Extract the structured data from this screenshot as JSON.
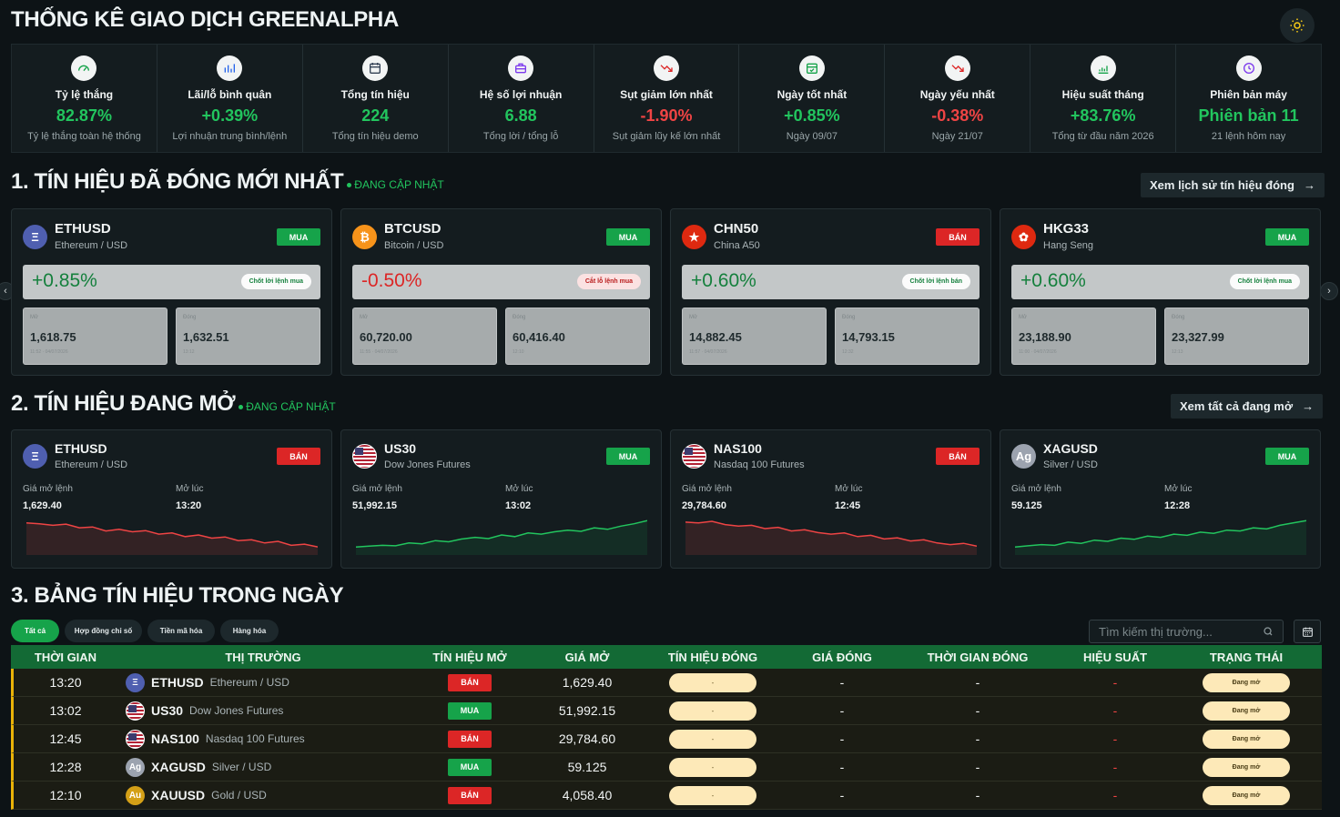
{
  "header": {
    "title": "THỐNG KÊ GIAO DỊCH GREENALPHA"
  },
  "colors": {
    "green": "#22c55e",
    "red": "#ef4444",
    "bg": "#0d1316",
    "table_header": "#136a35"
  },
  "stats": [
    {
      "label": "Tỷ lệ thắng",
      "value": "82.87%",
      "sub": "Tỷ lệ thắng toàn hệ thống",
      "tone": "g",
      "icon": "gauge-icon",
      "icon_color": "#16a34a"
    },
    {
      "label": "Lãi/lỗ bình quân",
      "value": "+0.39%",
      "sub": "Lợi nhuận trung bình/lệnh",
      "tone": "g",
      "icon": "bar-chart-icon",
      "icon_color": "#2563eb"
    },
    {
      "label": "Tổng tín hiệu",
      "value": "224",
      "sub": "Tổng tín hiệu demo",
      "tone": "g",
      "icon": "calendar-icon",
      "icon_color": "#334155"
    },
    {
      "label": "Hệ số lợi nhuận",
      "value": "6.88",
      "sub": "Tổng lời / tổng lỗ",
      "tone": "g",
      "icon": "briefcase-icon",
      "icon_color": "#7c3aed"
    },
    {
      "label": "Sụt giảm lớn nhất",
      "value": "-1.90%",
      "sub": "Sụt giảm lũy kế lớn nhất",
      "tone": "r",
      "icon": "trend-down-icon",
      "icon_color": "#dc2626"
    },
    {
      "label": "Ngày tốt nhất",
      "value": "+0.85%",
      "sub": "Ngày 09/07",
      "tone": "g",
      "icon": "calendar-check-icon",
      "icon_color": "#16a34a"
    },
    {
      "label": "Ngày yếu nhất",
      "value": "-0.38%",
      "sub": "Ngày 21/07",
      "tone": "r",
      "icon": "trend-down-icon",
      "icon_color": "#dc2626"
    },
    {
      "label": "Hiệu suất tháng",
      "value": "+83.76%",
      "sub": "Tổng từ đầu năm 2026",
      "tone": "g",
      "icon": "growth-chart-icon",
      "icon_color": "#16a34a"
    },
    {
      "label": "Phiên bản máy",
      "value": "Phiên bản 11",
      "sub": "21 lệnh hôm nay",
      "tone": "g",
      "icon": "clock-icon",
      "icon_color": "#7c3aed"
    }
  ],
  "section1": {
    "title": "1. TÍN HIỆU ĐÃ ĐÓNG MỚI NHẤT",
    "live": "ĐANG CẬP NHẬT",
    "link": "Xem lịch sử tín hiệu đóng"
  },
  "closed": [
    {
      "symbol": "ETHUSD",
      "name": "Ethereum / USD",
      "side": "MUA",
      "sideTone": "g",
      "pct": "+0.85%",
      "pctTone": "g",
      "note": "Chốt lời lệnh mua",
      "noteTone": "g2",
      "openLabel": "Mở",
      "openPrice": "1,618.75",
      "openTime": "11:52 · 04/07/2026",
      "closeLabel": "Đóng",
      "closePrice": "1,632.51",
      "closeTime": "13:12",
      "coin": "Ξ",
      "coinBg": "#4f5fb0"
    },
    {
      "symbol": "BTCUSD",
      "name": "Bitcoin / USD",
      "side": "MUA",
      "sideTone": "g",
      "pct": "-0.50%",
      "pctTone": "r",
      "note": "Cắt lỗ lệnh mua",
      "noteTone": "r2",
      "openLabel": "Mở",
      "openPrice": "60,720.00",
      "openTime": "11:55 · 04/07/2026",
      "closeLabel": "Đóng",
      "closePrice": "60,416.40",
      "closeTime": "12:10",
      "coin": "₿",
      "coinBg": "#f7931a"
    },
    {
      "symbol": "CHN50",
      "name": "China A50",
      "side": "BÁN",
      "sideTone": "r",
      "pct": "+0.60%",
      "pctTone": "g",
      "note": "Chốt lời lệnh bán",
      "noteTone": "g2",
      "openLabel": "Mở",
      "openPrice": "14,882.45",
      "openTime": "11:57 · 04/07/2026",
      "closeLabel": "Đóng",
      "closePrice": "14,793.15",
      "closeTime": "12:32",
      "coin": "★",
      "coinBg": "#de2910"
    },
    {
      "symbol": "HKG33",
      "name": "Hang Seng",
      "side": "MUA",
      "sideTone": "g",
      "pct": "+0.60%",
      "pctTone": "g",
      "note": "Chốt lời lệnh mua",
      "noteTone": "g2",
      "openLabel": "Mở",
      "openPrice": "23,188.90",
      "openTime": "11:00 · 04/07/2026",
      "closeLabel": "Đóng",
      "closePrice": "23,327.99",
      "closeTime": "12:13",
      "coin": "✿",
      "coinBg": "#de2910"
    }
  ],
  "section2": {
    "title": "2. TÍN HIỆU ĐANG MỞ",
    "live": "ĐANG CẬP NHẬT",
    "link": "Xem tất cả đang mở"
  },
  "open": [
    {
      "symbol": "ETHUSD",
      "name": "Ethereum / USD",
      "side": "BÁN",
      "sideTone": "r",
      "priceLabel": "Giá mở lệnh",
      "price": "1,629.40",
      "timeLabel": "Mở lúc",
      "time": "13:20",
      "coin": "Ξ",
      "coinBg": "#4f5fb0",
      "trend": "down",
      "spark": [
        0.8,
        0.78,
        0.74,
        0.77,
        0.68,
        0.7,
        0.6,
        0.64,
        0.58,
        0.61,
        0.52,
        0.55,
        0.46,
        0.5,
        0.42,
        0.45,
        0.36,
        0.38,
        0.3,
        0.34,
        0.24,
        0.27,
        0.2
      ]
    },
    {
      "symbol": "US30",
      "name": "Dow Jones Futures",
      "side": "MUA",
      "sideTone": "g",
      "priceLabel": "Giá mở lệnh",
      "price": "51,992.15",
      "timeLabel": "Mở lúc",
      "time": "13:02",
      "coin": "us",
      "coinBg": "#b22234",
      "trend": "up",
      "spark": [
        0.2,
        0.22,
        0.24,
        0.23,
        0.3,
        0.28,
        0.36,
        0.33,
        0.4,
        0.44,
        0.41,
        0.5,
        0.46,
        0.55,
        0.52,
        0.58,
        0.62,
        0.59,
        0.68,
        0.64,
        0.72,
        0.78,
        0.86
      ]
    },
    {
      "symbol": "NAS100",
      "name": "Nasdaq 100 Futures",
      "side": "BÁN",
      "sideTone": "r",
      "priceLabel": "Giá mở lệnh",
      "price": "29,784.60",
      "timeLabel": "Mở lúc",
      "time": "12:45",
      "coin": "us",
      "coinBg": "#b22234",
      "trend": "down",
      "spark": [
        0.82,
        0.8,
        0.84,
        0.76,
        0.72,
        0.74,
        0.66,
        0.69,
        0.6,
        0.63,
        0.56,
        0.52,
        0.55,
        0.46,
        0.49,
        0.4,
        0.43,
        0.35,
        0.38,
        0.3,
        0.26,
        0.29,
        0.22
      ]
    },
    {
      "symbol": "XAGUSD",
      "name": "Silver / USD",
      "side": "MUA",
      "sideTone": "g",
      "priceLabel": "Giá mở lệnh",
      "price": "59.125",
      "timeLabel": "Mở lúc",
      "time": "12:28",
      "coin": "Ag",
      "coinBg": "#9ca3af",
      "trend": "up",
      "spark": [
        0.2,
        0.23,
        0.26,
        0.24,
        0.32,
        0.29,
        0.37,
        0.34,
        0.42,
        0.39,
        0.47,
        0.44,
        0.52,
        0.49,
        0.57,
        0.54,
        0.62,
        0.6,
        0.68,
        0.65,
        0.74,
        0.8,
        0.86
      ]
    }
  ],
  "section3": {
    "title": "3. BẢNG TÍN HIỆU TRONG NGÀY"
  },
  "tabs": [
    "Tất cả",
    "Hợp đồng chỉ số",
    "Tiền mã hóa",
    "Hàng hóa"
  ],
  "search": {
    "placeholder": "Tìm kiếm thị trường..."
  },
  "table": {
    "headers": [
      "THỜI GIAN",
      "THỊ TRƯỜNG",
      "TÍN HIỆU MỞ",
      "GIÁ MỞ",
      "TÍN HIỆU ĐÓNG",
      "GIÁ ĐÓNG",
      "THỜI GIAN ĐÓNG",
      "HIỆU SUẤT",
      "TRẠNG THÁI"
    ],
    "rows": [
      {
        "time": "13:20",
        "symbol": "ETHUSD",
        "name": "Ethereum / USD",
        "side": "BÁN",
        "tone": "r",
        "price": "1,629.40",
        "closeSig": "-",
        "closePrice": "-",
        "closeTime": "-",
        "perf": "-",
        "status": "Đang mở",
        "coin": "Ξ",
        "coinBg": "#4f5fb0"
      },
      {
        "time": "13:02",
        "symbol": "US30",
        "name": "Dow Jones Futures",
        "side": "MUA",
        "tone": "g",
        "price": "51,992.15",
        "closeSig": "-",
        "closePrice": "-",
        "closeTime": "-",
        "perf": "-",
        "status": "Đang mở",
        "coin": "us",
        "coinBg": "#b22234"
      },
      {
        "time": "12:45",
        "symbol": "NAS100",
        "name": "Nasdaq 100 Futures",
        "side": "BÁN",
        "tone": "r",
        "price": "29,784.60",
        "closeSig": "-",
        "closePrice": "-",
        "closeTime": "-",
        "perf": "-",
        "status": "Đang mở",
        "coin": "us",
        "coinBg": "#b22234"
      },
      {
        "time": "12:28",
        "symbol": "XAGUSD",
        "name": "Silver / USD",
        "side": "MUA",
        "tone": "g",
        "price": "59.125",
        "closeSig": "-",
        "closePrice": "-",
        "closeTime": "-",
        "perf": "-",
        "status": "Đang mở",
        "coin": "Ag",
        "coinBg": "#9ca3af"
      },
      {
        "time": "12:10",
        "symbol": "XAUUSD",
        "name": "Gold / USD",
        "side": "BÁN",
        "tone": "r",
        "price": "4,058.40",
        "closeSig": "-",
        "closePrice": "-",
        "closeTime": "-",
        "perf": "-",
        "status": "Đang mở",
        "coin": "Au",
        "coinBg": "#d4a017"
      }
    ]
  }
}
